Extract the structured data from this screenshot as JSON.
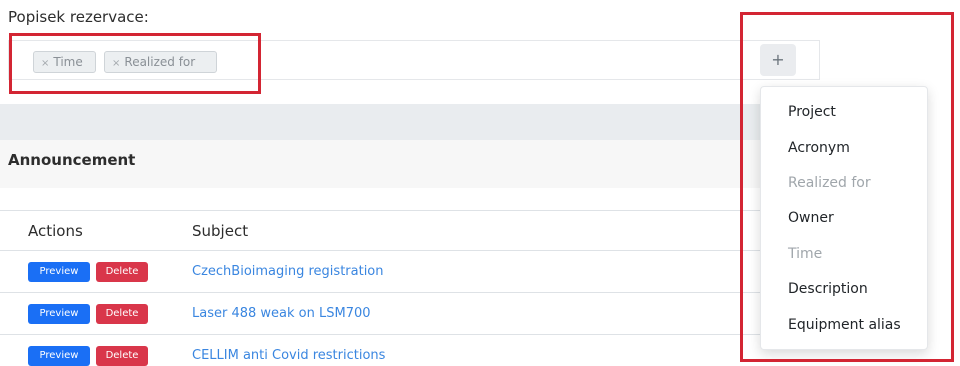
{
  "reservation": {
    "label": "Popisek rezervace:",
    "tags": [
      {
        "remove": "×",
        "label": "Time"
      },
      {
        "remove": "×",
        "label": "Realized for"
      }
    ],
    "add_button": "+"
  },
  "announcement": {
    "title": "Announcement",
    "columns": [
      "Actions",
      "Subject"
    ],
    "rows": [
      {
        "preview": "Preview",
        "delete": "Delete",
        "subject": "CzechBioimaging registration"
      },
      {
        "preview": "Preview",
        "delete": "Delete",
        "subject": "Laser 488 weak on LSM700"
      },
      {
        "preview": "Preview",
        "delete": "Delete",
        "subject": "CELLIM anti Covid restrictions"
      }
    ]
  },
  "dropdown": {
    "items": [
      {
        "label": "Project",
        "enabled": true
      },
      {
        "label": "Acronym",
        "enabled": true
      },
      {
        "label": "Realized for",
        "enabled": false
      },
      {
        "label": "Owner",
        "enabled": true
      },
      {
        "label": "Time",
        "enabled": false
      },
      {
        "label": "Description",
        "enabled": true
      },
      {
        "label": "Equipment alias",
        "enabled": true
      }
    ]
  },
  "colors": {
    "highlight_box": "#d32533",
    "preview_button": "#1a6ff5",
    "delete_button": "#d9364a",
    "link": "#3a86e0"
  }
}
